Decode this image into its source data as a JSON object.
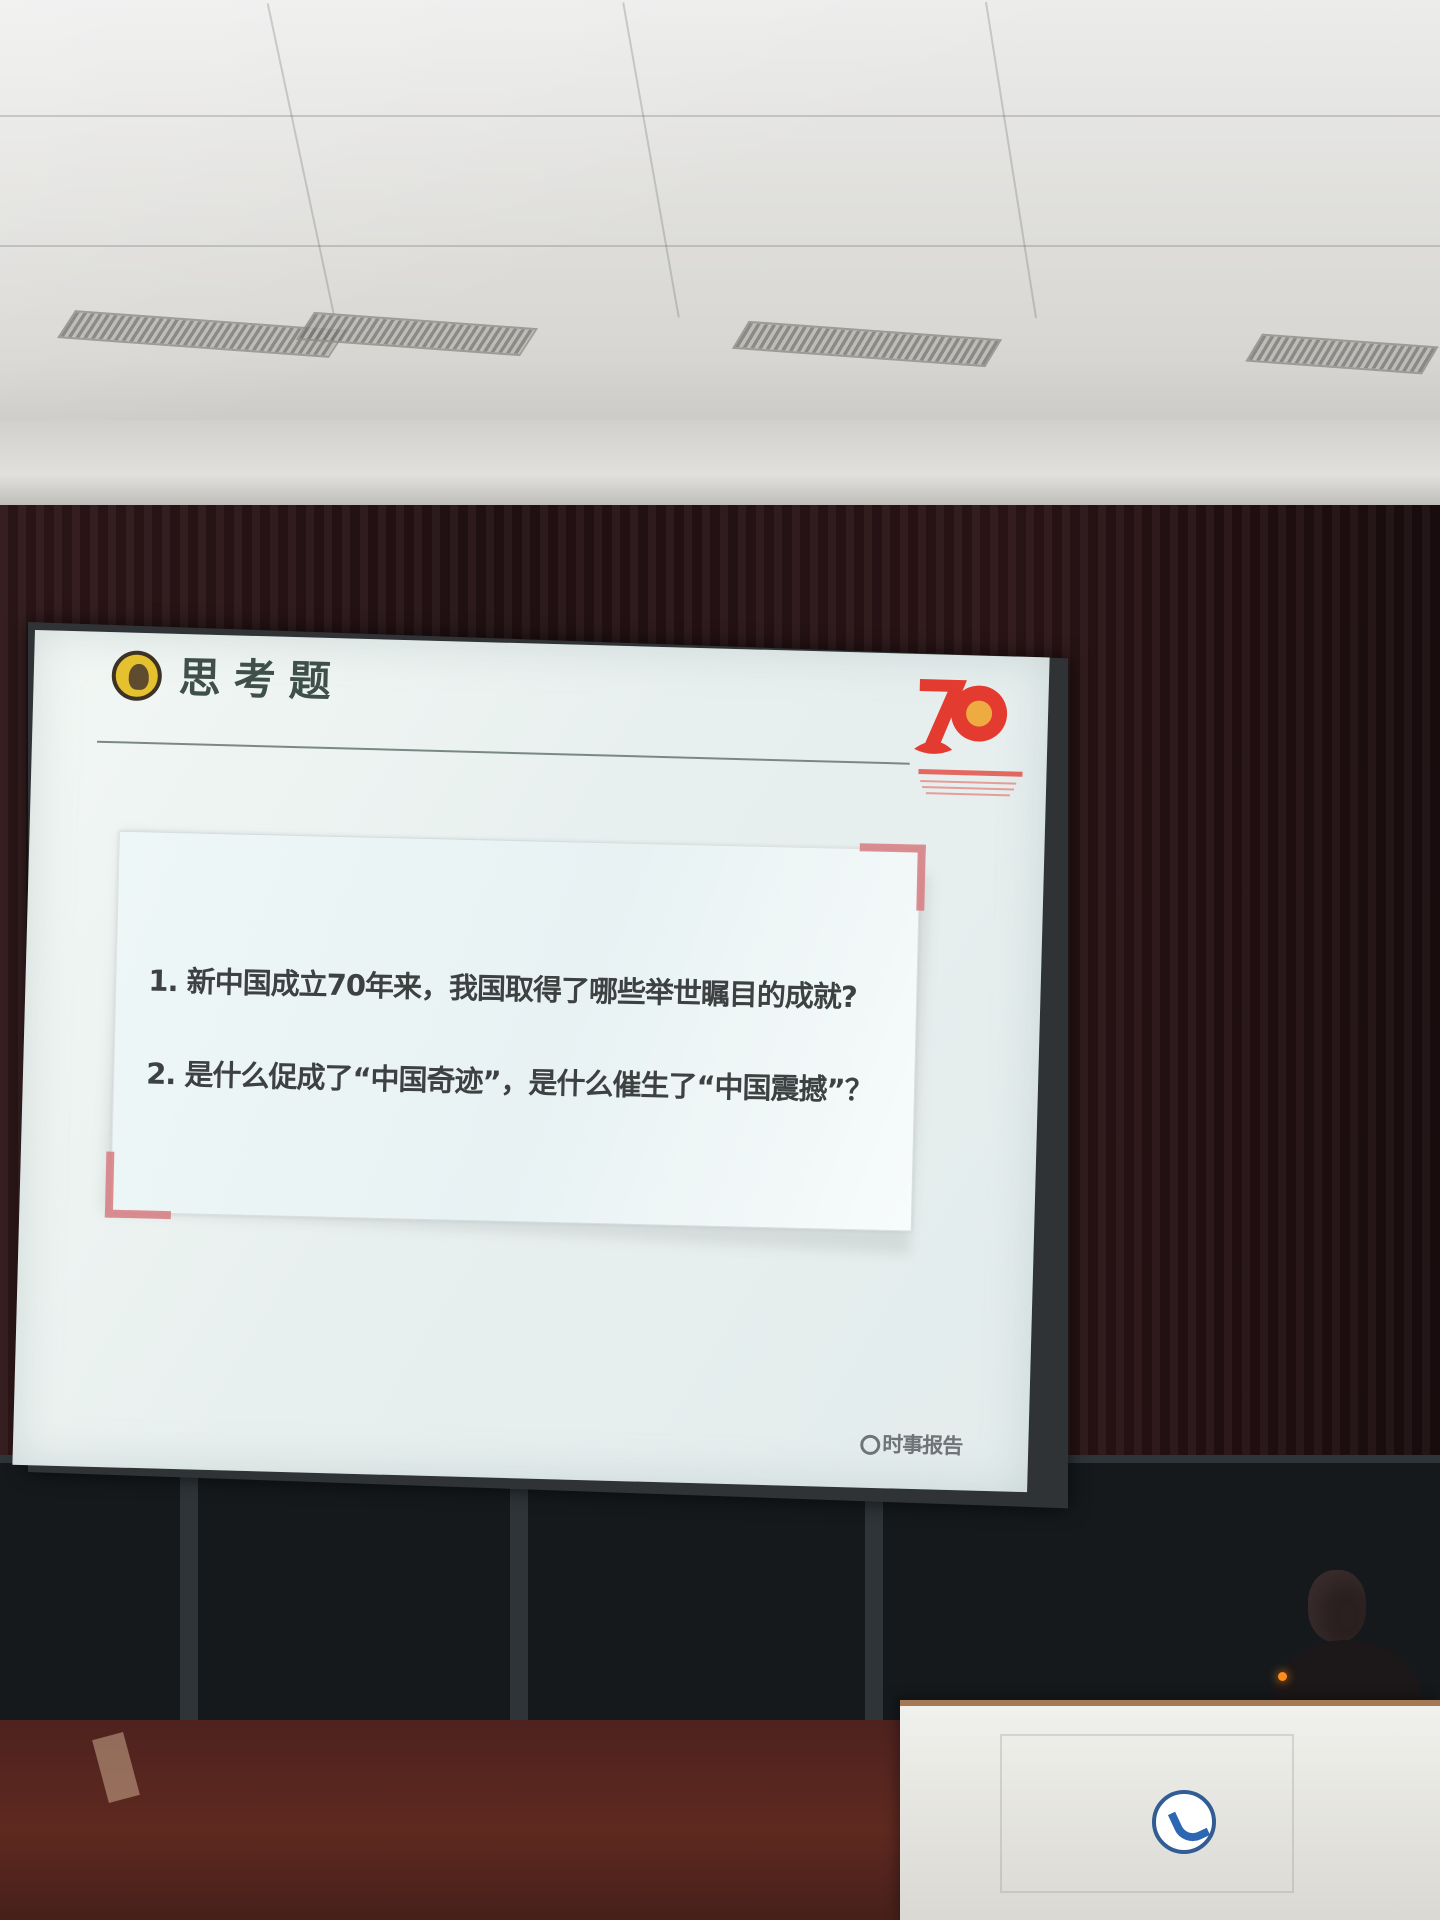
{
  "slide": {
    "title": "思考题",
    "questions": [
      "1. 新中国成立70年来，我国取得了哪些举世瞩目的成就?",
      "2. 是什么促成了“中国奇迹”，是什么催生了“中国震撼”？"
    ],
    "footer_label": "时事报告"
  },
  "colors": {
    "anniversary_red": "#e33b2f",
    "slide_background": "#edf5f4",
    "text": "#3e4142",
    "corner_accent": "#d77c81"
  },
  "icons": {
    "slide_logo": "round-yellow-portrait-icon",
    "anniversary": "70th-anniversary-logo",
    "footer": "publication-logo-icon",
    "podium": "school-emblem-icon"
  }
}
